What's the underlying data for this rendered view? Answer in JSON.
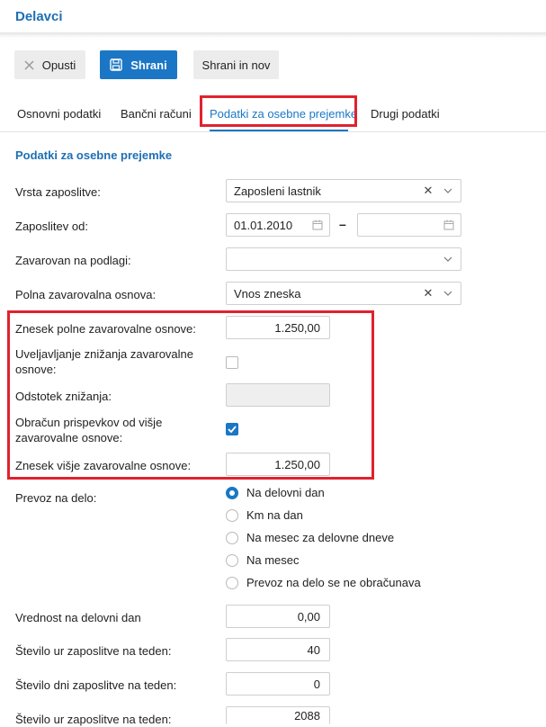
{
  "header": {
    "title": "Delavci"
  },
  "toolbar": {
    "discard_label": "Opusti",
    "save_label": "Shrani",
    "save_new_label": "Shrani in nov"
  },
  "tabs": [
    {
      "label": "Osnovni podatki",
      "active": false
    },
    {
      "label": "Bančni računi",
      "active": false
    },
    {
      "label": "Podatki za osebne prejemke",
      "active": true
    },
    {
      "label": "Drugi podatki",
      "active": false
    }
  ],
  "section": {
    "title": "Podatki za osebne prejemke"
  },
  "form": {
    "employment_type": {
      "label": "Vrsta zaposlitve:",
      "value": "Zaposleni lastnik"
    },
    "employed_from": {
      "label": "Zaposlitev od:",
      "value_from": "01.01.2010",
      "value_to": ""
    },
    "insured_basis": {
      "label": "Zavarovan na podlagi:",
      "value": ""
    },
    "full_insurance_basis": {
      "label": "Polna zavarovalna osnova:",
      "value": "Vnos zneska"
    },
    "full_basis_amount": {
      "label": "Znesek polne zavarovalne osnove:",
      "value": "1.250,00"
    },
    "reduction_claim": {
      "label": "Uveljavljanje znižanja zavarovalne osnove:",
      "checked": false
    },
    "reduction_percent": {
      "label": "Odstotek znižanja:",
      "value": ""
    },
    "higher_basis_calc": {
      "label": "Obračun prispevkov od višje zavarovalne osnove:",
      "checked": true
    },
    "higher_basis_amount": {
      "label": "Znesek višje zavarovalne osnove:",
      "value": "1.250,00"
    },
    "commute": {
      "label": "Prevoz na delo:",
      "options": [
        "Na delovni dan",
        "Km na dan",
        "Na mesec za delovne dneve",
        "Na mesec",
        "Prevoz na delo se ne obračunava"
      ],
      "selected": "Na delovni dan"
    },
    "value_per_workday": {
      "label": "Vrednost na delovni dan",
      "value": "0,00"
    },
    "hours_per_week": {
      "label": "Število ur zaposlitve na teden:",
      "value": "40"
    },
    "days_per_week": {
      "label": "Število dni zaposlitve na teden:",
      "value": "0"
    },
    "hours_per_week_2": {
      "label": "Število ur zaposlitve na teden:",
      "value": "2088"
    }
  },
  "colors": {
    "accent": "#1b77c5",
    "highlight": "#e0222e",
    "title": "#1e6fb3"
  }
}
